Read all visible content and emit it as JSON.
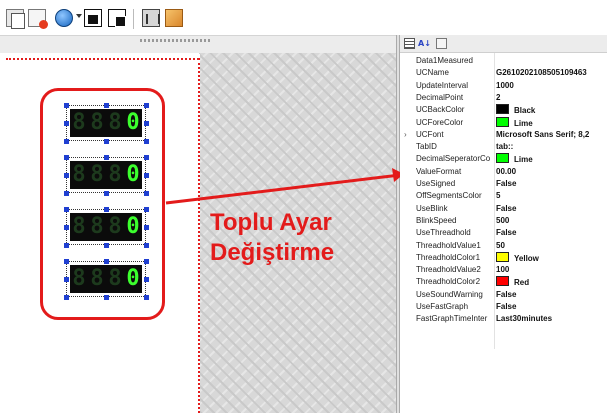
{
  "toolbar": {
    "icons": [
      "copy-icon",
      "paste-icon",
      "globe-icon",
      "dropdown-icon",
      "window-icon",
      "windows-icon",
      "building-icon",
      "package-icon"
    ]
  },
  "displays": [
    {
      "digits": [
        "8",
        "8",
        "8",
        "0"
      ],
      "lit": [
        false,
        false,
        false,
        true
      ]
    },
    {
      "digits": [
        "8",
        "8",
        "8",
        "0"
      ],
      "lit": [
        false,
        false,
        false,
        true
      ]
    },
    {
      "digits": [
        "8",
        "8",
        "8",
        "0"
      ],
      "lit": [
        false,
        false,
        false,
        true
      ]
    },
    {
      "digits": [
        "8",
        "8",
        "8",
        "0"
      ],
      "lit": [
        false,
        false,
        false,
        true
      ]
    }
  ],
  "annotation": {
    "line1": "Toplu Ayar",
    "line2": "Değiştirme",
    "color": "#e31b1b"
  },
  "properties": {
    "toolbar_icons": [
      "categorized-icon",
      "alphabetical-icon",
      "property-pages-icon"
    ],
    "rows": [
      {
        "name": "Data1Measured",
        "value": "",
        "swatch": null,
        "expandable": false
      },
      {
        "name": "UCName",
        "value": "G2610202108505109463",
        "swatch": null,
        "expandable": false
      },
      {
        "name": "UpdateInterval",
        "value": "1000",
        "swatch": null,
        "expandable": false
      },
      {
        "name": "DecimalPoint",
        "value": "2",
        "swatch": null,
        "expandable": false
      },
      {
        "name": "UCBackColor",
        "value": "Black",
        "swatch": "#000000",
        "expandable": false
      },
      {
        "name": "UCForeColor",
        "value": "Lime",
        "swatch": "#00ff00",
        "expandable": false
      },
      {
        "name": "UCFont",
        "value": "Microsoft Sans Serif; 8,2",
        "swatch": null,
        "expandable": true
      },
      {
        "name": "TabID",
        "value": "tab::",
        "swatch": null,
        "expandable": false
      },
      {
        "name": "DecimalSeperatorCo",
        "value": "Lime",
        "swatch": "#00ff00",
        "expandable": false
      },
      {
        "name": "ValueFormat",
        "value": "00.00",
        "swatch": null,
        "expandable": false
      },
      {
        "name": "UseSigned",
        "value": "False",
        "swatch": null,
        "expandable": false
      },
      {
        "name": "OffSegmentsColor",
        "value": "5",
        "swatch": null,
        "expandable": false
      },
      {
        "name": "UseBlink",
        "value": "False",
        "swatch": null,
        "expandable": false
      },
      {
        "name": "BlinkSpeed",
        "value": "500",
        "swatch": null,
        "expandable": false
      },
      {
        "name": "UseThreadhold",
        "value": "False",
        "swatch": null,
        "expandable": false
      },
      {
        "name": "ThreadholdValue1",
        "value": "50",
        "swatch": null,
        "expandable": false
      },
      {
        "name": "ThreadholdColor1",
        "value": "Yellow",
        "swatch": "#ffff00",
        "expandable": false
      },
      {
        "name": "ThreadholdValue2",
        "value": "100",
        "swatch": null,
        "expandable": false
      },
      {
        "name": "ThreadholdColor2",
        "value": "Red",
        "swatch": "#ff0000",
        "expandable": false
      },
      {
        "name": "UseSoundWarning",
        "value": "False",
        "swatch": null,
        "expandable": false
      },
      {
        "name": "UseFastGraph",
        "value": "False",
        "swatch": null,
        "expandable": false
      },
      {
        "name": "FastGraphTimeInter",
        "value": "Last30minutes",
        "swatch": null,
        "expandable": false
      }
    ]
  }
}
